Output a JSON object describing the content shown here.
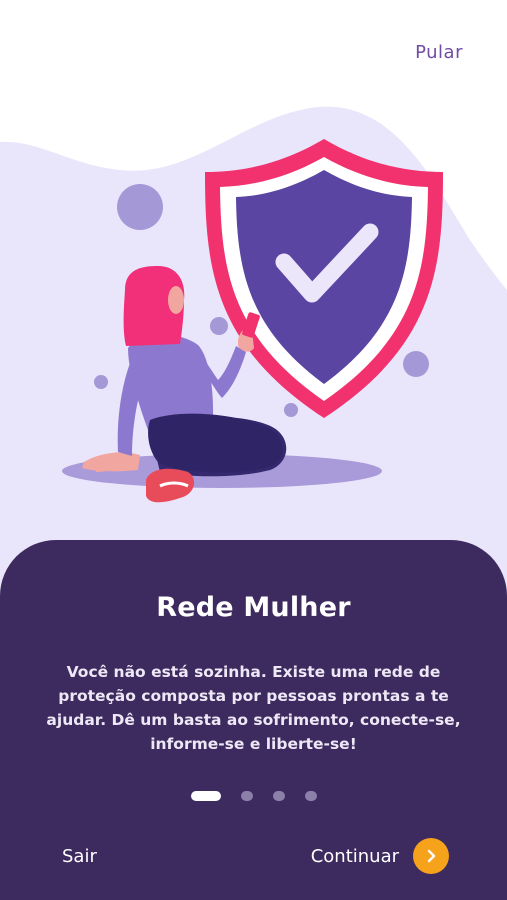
{
  "header": {
    "skip_label": "Pular"
  },
  "illustration": {
    "icon": "shield-check-icon",
    "description_icon": "woman-with-phone-illustration"
  },
  "content": {
    "title": "Rede Mulher",
    "description": "Você não está sozinha. Existe uma rede de proteção composta por pessoas prontas a te ajudar. Dê um basta ao sofrimento, conecte-se, informe-se e liberte-se!"
  },
  "pagination": {
    "total": 4,
    "active_index": 0
  },
  "footer": {
    "exit_label": "Sair",
    "continue_label": "Continuar",
    "continue_icon": "chevron-right-icon"
  },
  "colors": {
    "accent": "#6f4ca8",
    "card_background": "#3d2a5e",
    "button_orange": "#f7a21b",
    "shield_pink": "#f2326f",
    "shield_purple": "#5a45a3",
    "background_lavender": "#e9e6fb"
  }
}
